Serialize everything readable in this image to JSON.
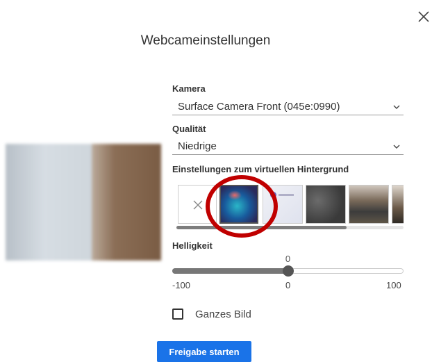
{
  "dialog": {
    "title": "Webcameinstellungen"
  },
  "camera": {
    "label": "Kamera",
    "selected": "Surface Camera Front (045e:0990)"
  },
  "quality": {
    "label": "Qualität",
    "selected": "Niedrige"
  },
  "virtual_background": {
    "label": "Einstellungen zum virtuellen Hintergrund",
    "selected_index": 1
  },
  "brightness": {
    "label": "Helligkeit",
    "value": "0",
    "min": "-100",
    "mid": "0",
    "max": "100",
    "value_num": 0,
    "min_num": -100,
    "max_num": 100
  },
  "full_image": {
    "label": "Ganzes Bild",
    "checked": false
  },
  "actions": {
    "start_label": "Freigabe starten"
  },
  "colors": {
    "primary": "#1a73e8",
    "highlight_ring": "#c00000"
  }
}
